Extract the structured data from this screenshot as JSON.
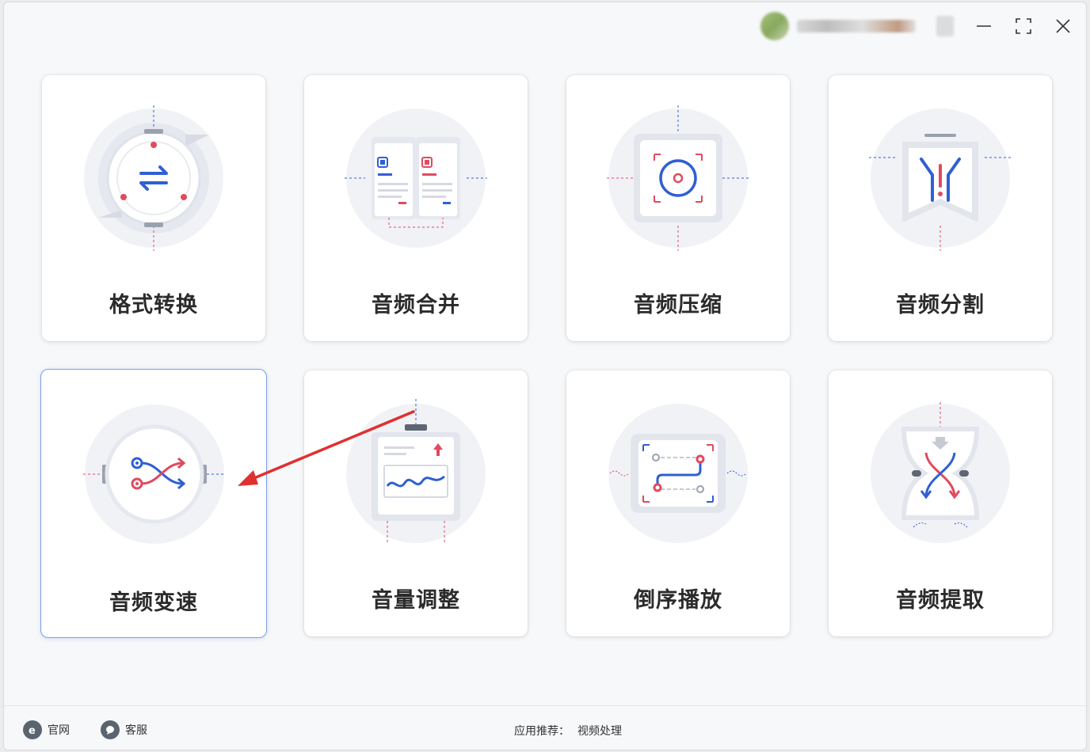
{
  "window": {
    "controls": [
      "minimize-icon",
      "maximize-icon",
      "close-icon"
    ]
  },
  "cards": [
    {
      "label": "格式转换",
      "icon": "format-convert-icon"
    },
    {
      "label": "音频合并",
      "icon": "audio-merge-icon"
    },
    {
      "label": "音频压缩",
      "icon": "audio-compress-icon"
    },
    {
      "label": "音频分割",
      "icon": "audio-split-icon"
    },
    {
      "label": "音频变速",
      "icon": "audio-speed-icon",
      "selected": true
    },
    {
      "label": "音量调整",
      "icon": "volume-adjust-icon"
    },
    {
      "label": "倒序播放",
      "icon": "reverse-play-icon"
    },
    {
      "label": "音频提取",
      "icon": "audio-extract-icon"
    }
  ],
  "footer": {
    "website_label": "官网",
    "support_label": "客服",
    "recommend_prefix": "应用推荐：",
    "recommend_app": "视频处理"
  },
  "colors": {
    "accent_blue": "#2f5fd3",
    "accent_red": "#e04a5f",
    "annotation_arrow": "#e03030"
  }
}
